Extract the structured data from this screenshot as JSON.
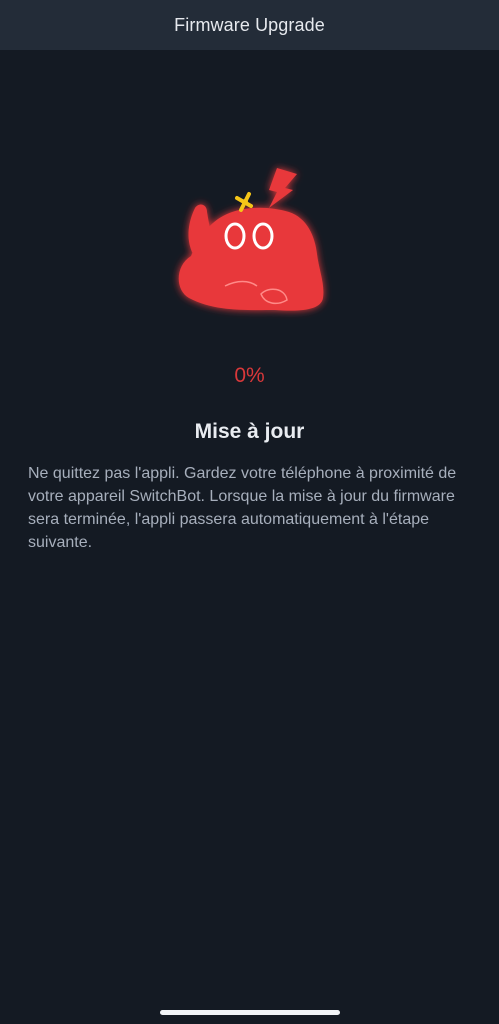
{
  "header": {
    "title": "Firmware Upgrade"
  },
  "progress": {
    "percent_label": "0%",
    "value": 0
  },
  "content": {
    "heading": "Mise à jour",
    "description": "Ne quittez pas l'appli. Gardez votre téléphone à proximité de votre appareil SwitchBot. Lorsque la mise à jour du firmware sera terminée, l'appli passera automatiquement à l'étape suivante."
  },
  "colors": {
    "background": "#141a23",
    "header_background": "#232c38",
    "accent_red": "#e8393b",
    "accent_yellow": "#f5c518"
  },
  "icons": {
    "mascot": "red-robot-mascot-icon"
  }
}
